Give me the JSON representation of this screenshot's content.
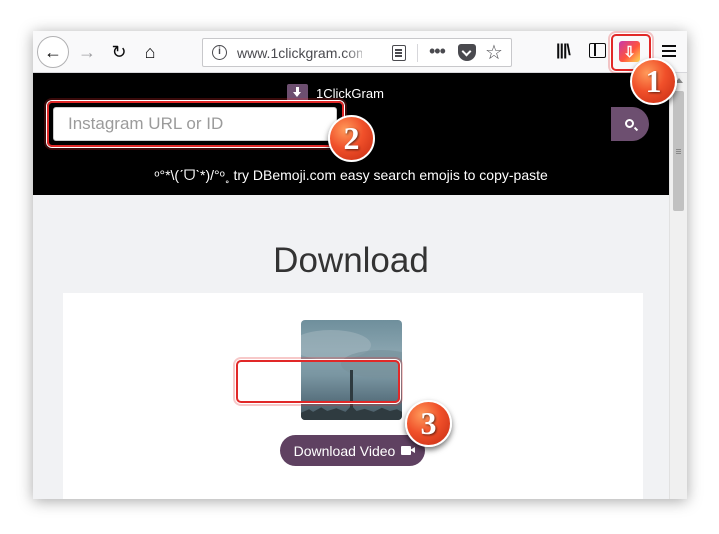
{
  "browser": {
    "url": "www.1clickgram.com",
    "extension_icon": "download-extension-icon"
  },
  "site": {
    "logo_text": "1ClickGram",
    "search_placeholder": "Instagram URL or ID",
    "promo_text": "ᵒ°*\\(ˊᗜˋ*)/°ᵒ˳ try DBemoji.com easy search emojis to copy-paste",
    "download_heading": "Download",
    "download_button_label": "Download Video"
  },
  "annotations": {
    "step1": "1",
    "step2": "2",
    "step3": "3"
  },
  "colors": {
    "accent": "#6d4f70",
    "header_bg": "#000000",
    "highlight": "#e12828",
    "badge": "#f0502a"
  }
}
